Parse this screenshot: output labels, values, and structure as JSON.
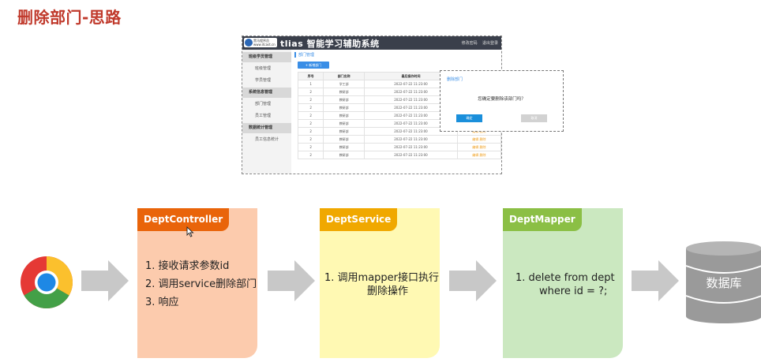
{
  "title": "删除部门-思路",
  "mini_app": {
    "logo_text_line1": "黑马程序员",
    "logo_text_line2": "www.itcast.cn",
    "app_title": "tlias 智能学习辅助系统",
    "user_actions": [
      "修改密码",
      "退出登录"
    ],
    "sidebar": [
      {
        "label": "班级学员管理",
        "group": true
      },
      {
        "label": "班级管理",
        "group": false
      },
      {
        "label": "学员管理",
        "group": false
      },
      {
        "label": "系统信息管理",
        "group": true
      },
      {
        "label": "部门管理",
        "group": false
      },
      {
        "label": "员工管理",
        "group": false
      },
      {
        "label": "数据统计管理",
        "group": true
      },
      {
        "label": "员工信息统计",
        "group": false
      }
    ],
    "breadcrumb": "部门管理",
    "add_button": "+ 新增部门",
    "table": {
      "headers": [
        "序号",
        "部门名称",
        "最后操作时间",
        "操作"
      ],
      "rows": [
        [
          "1",
          "学工部",
          "2022-07-22 11:23:00",
          "编辑 删除"
        ],
        [
          "2",
          "教研部",
          "2022-07-22 11:23:00",
          "编辑 删除"
        ],
        [
          "2",
          "教研部",
          "2022-07-22 11:23:00",
          "编辑 删除"
        ],
        [
          "2",
          "教研部",
          "2022-07-22 11:23:00",
          "编辑 删除"
        ],
        [
          "2",
          "教研部",
          "2022-07-22 11:23:00",
          "编辑 删除"
        ],
        [
          "2",
          "教研部",
          "2022-07-22 11:23:00",
          "编辑 删除"
        ],
        [
          "2",
          "教研部",
          "2022-07-22 11:23:00",
          "编辑 删除"
        ],
        [
          "2",
          "教研部",
          "2022-07-22 11:23:00",
          "编辑 删除"
        ],
        [
          "2",
          "教研部",
          "2022-07-22 11:23:00",
          "编辑 删除"
        ],
        [
          "2",
          "教研部",
          "2022-07-22 11:23:00",
          "编辑 删除"
        ]
      ]
    }
  },
  "dialog": {
    "title": "删除部门",
    "message": "您确定要删除该部门吗？",
    "ok_label": "确定",
    "cancel_label": "取消"
  },
  "flow": {
    "controller": {
      "name": "DeptController",
      "steps": [
        "1.  接收请求参数id",
        "2.  调用service删除部门",
        "3.  响应"
      ]
    },
    "service": {
      "name": "DeptService",
      "steps": [
        "1.  调用mapper接口执行",
        "删除操作"
      ]
    },
    "mapper": {
      "name": "DeptMapper",
      "steps": [
        "1.  delete from dept",
        "where id = ?;"
      ]
    },
    "database_label": "数据库"
  },
  "icons": [
    "chrome-browser-icon",
    "database-icon",
    "mouse-cursor-icon"
  ],
  "colors": {
    "title": "#c0392b",
    "controller_tag": "#e9640a",
    "controller_box": "#fccbad",
    "service_tag": "#f0a800",
    "service_box": "#fff9b3",
    "mapper_tag": "#8bbf45",
    "mapper_box": "#cbe8c0",
    "arrow": "#c8c8c8",
    "database": "#9a9a9a"
  }
}
